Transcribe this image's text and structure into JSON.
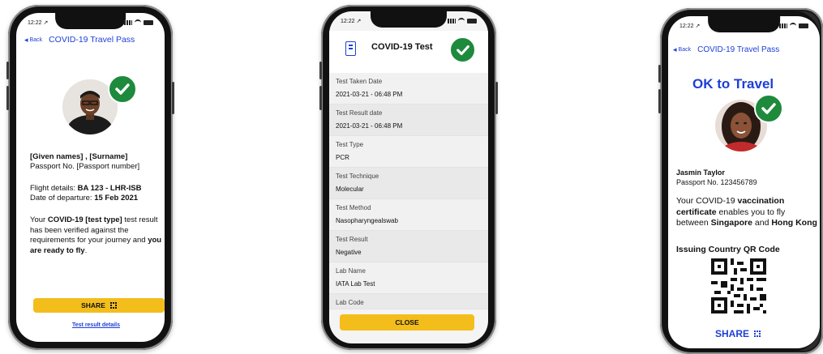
{
  "phone1": {
    "status_time": "12:22 ↗",
    "back_label": "Back",
    "nav_title": "COVID-19 Travel Pass",
    "name_line": "[Given names] , [Surname]",
    "passport_line": "Passport No. [Passport number]",
    "flight_label": "Flight details: ",
    "flight_value": "BA 123 - LHR-ISB",
    "departure_label": "Date of departure: ",
    "departure_value": "15 Feb 2021",
    "msg_1": "Your ",
    "msg_2": "COVID-19 [test type]",
    "msg_3": " test result has been verified against the requirements for your journey and ",
    "msg_4": "you are ready to fly",
    "msg_5": ".",
    "share_label": "SHARE",
    "details_link": "Test result details"
  },
  "phone2": {
    "status_time": "12:22 ↗",
    "title": "COVID-19 Test",
    "rows": [
      {
        "label": "Test Taken Date",
        "value": "2021-03-21 - 06:48 PM"
      },
      {
        "label": "Test Result date",
        "value": "2021-03-21 - 06:48 PM"
      },
      {
        "label": "Test Type",
        "value": "PCR"
      },
      {
        "label": "Test Technique",
        "value": "Molecular"
      },
      {
        "label": "Test Method",
        "value": "Nasopharyngealswab"
      },
      {
        "label": "Test Result",
        "value": "Negative"
      },
      {
        "label": "Lab Name",
        "value": "IATA Lab Test"
      },
      {
        "label": "Lab Code",
        "value": ""
      }
    ],
    "close_label": "CLOSE"
  },
  "phone3": {
    "status_time": "12:22 ↗",
    "back_label": "Back",
    "nav_title": "COVID-19 Travel Pass",
    "ok_title": "OK to Travel",
    "name": "Jasmin Taylor",
    "passport": "Passport No. 123456789",
    "msg_1": "Your COVID-19 ",
    "msg_2": "vaccination certificate",
    "msg_3": " enables you to fly between ",
    "msg_4": "Singapore",
    "msg_5": " and ",
    "msg_6": "Hong Kong",
    "qr_title": "Issuing Country QR Code",
    "share_label": "SHARE"
  },
  "colors": {
    "link_blue": "#1d3fd6",
    "check_green": "#1e8a3c",
    "button_yellow": "#f3be1c"
  }
}
